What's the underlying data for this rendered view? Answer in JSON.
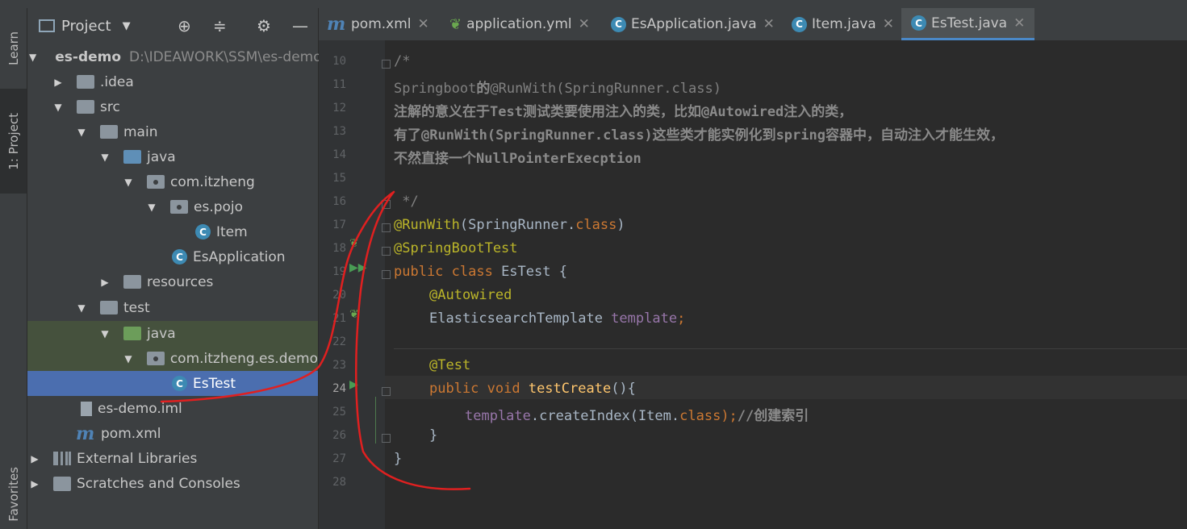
{
  "side_strip": {
    "learn": "Learn",
    "project": "1: Project",
    "favorites": "Favorites"
  },
  "panel": {
    "title": "Project"
  },
  "tree": [
    {
      "label": "es-demo",
      "extra": "D:\\IDEAWORK\\SSM\\es-demo"
    },
    {
      "label": ".idea"
    },
    {
      "label": "src"
    },
    {
      "label": "main"
    },
    {
      "label": "java"
    },
    {
      "label": "com.itzheng"
    },
    {
      "label": "es.pojo"
    },
    {
      "label": "Item"
    },
    {
      "label": "EsApplication"
    },
    {
      "label": "resources"
    },
    {
      "label": "test"
    },
    {
      "label": "java"
    },
    {
      "label": "com.itzheng.es.demo"
    },
    {
      "label": "EsTest"
    },
    {
      "label": "es-demo.iml"
    },
    {
      "label": "pom.xml"
    },
    {
      "label": "External Libraries"
    },
    {
      "label": "Scratches and Consoles"
    }
  ],
  "tabs": [
    {
      "label": "pom.xml",
      "icon": "maven-icon"
    },
    {
      "label": "application.yml",
      "icon": "spring-config-icon"
    },
    {
      "label": "EsApplication.java",
      "icon": "spring-class-icon"
    },
    {
      "label": "Item.java",
      "icon": "class-icon"
    },
    {
      "label": "EsTest.java",
      "icon": "test-class-icon"
    }
  ],
  "editor": {
    "line_numbers": [
      "10",
      "11",
      "12",
      "13",
      "14",
      "15",
      "16",
      "17",
      "18",
      "19",
      "20",
      "21",
      "22",
      "23",
      "24",
      "25",
      "26",
      "27",
      "28"
    ],
    "current_line": "24",
    "lines": {
      "l10": "/*",
      "l11a": "Springboot",
      "l11b": "的",
      "l11c": "@RunWith(SpringRunner.class)",
      "l12": "注解的意义在于Test测试类要使用注入的类，比如@Autowired注入的类，",
      "l13": "有了@RunWith(SpringRunner.class)这些类才能实例化到spring容器中，自动注入才能生效，",
      "l14": "不然直接一个NullPointerExecption",
      "l16": " */",
      "l17_ann": "@RunWith",
      "l17_rest1": "(SpringRunner.",
      "l17_kw": "class",
      "l17_rest2": ")",
      "l18": "@SpringBootTest",
      "l19_kw": "public class ",
      "l19_name": "EsTest {",
      "l20": "@Autowired",
      "l21_type": "ElasticsearchTemplate ",
      "l21_field": "template",
      "l21_semi": ";",
      "l23": "@Test",
      "l24_kw": "public void ",
      "l24_fn": "testCreate",
      "l24_rest": "(){",
      "l25_field": "template",
      "l25_call": ".createIndex(Item.",
      "l25_kw": "class",
      "l25_end": ");",
      "l25_cm": "//创建索引",
      "l26": "}",
      "l27": "}"
    }
  },
  "colors": {
    "accent": "#4a88c7",
    "selection": "#4b6eaf",
    "annotation_ink": "#e02020"
  }
}
